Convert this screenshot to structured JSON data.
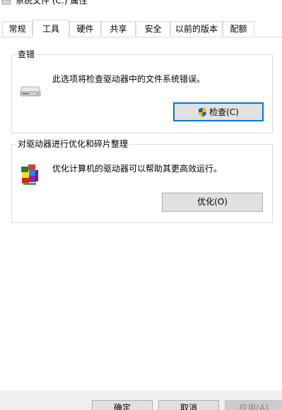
{
  "window": {
    "title": "系统文件 (C:) 属性"
  },
  "tabs": [
    {
      "label": "常规"
    },
    {
      "label": "工具"
    },
    {
      "label": "硬件"
    },
    {
      "label": "共享"
    },
    {
      "label": "安全"
    },
    {
      "label": "以前的版本"
    },
    {
      "label": "配额"
    }
  ],
  "active_tab": "工具",
  "error_check": {
    "title": "查错",
    "description": "此选项将检查驱动器中的文件系统错误。",
    "button_label": "检查(C)",
    "icon": "drive-icon"
  },
  "optimize": {
    "title": "对驱动器进行优化和碎片整理",
    "description": "优化计算机的驱动器可以帮助其更高效运行。",
    "button_label": "优化(O)",
    "icon": "defrag-icon"
  },
  "footer": {
    "ok_label": "确定",
    "cancel_label": "取消",
    "apply_label": "应用(A)"
  },
  "colors": {
    "default_button_border": "#0078d7",
    "button_face": "#e1e1e1",
    "footer_bg": "#f0f0f0"
  }
}
